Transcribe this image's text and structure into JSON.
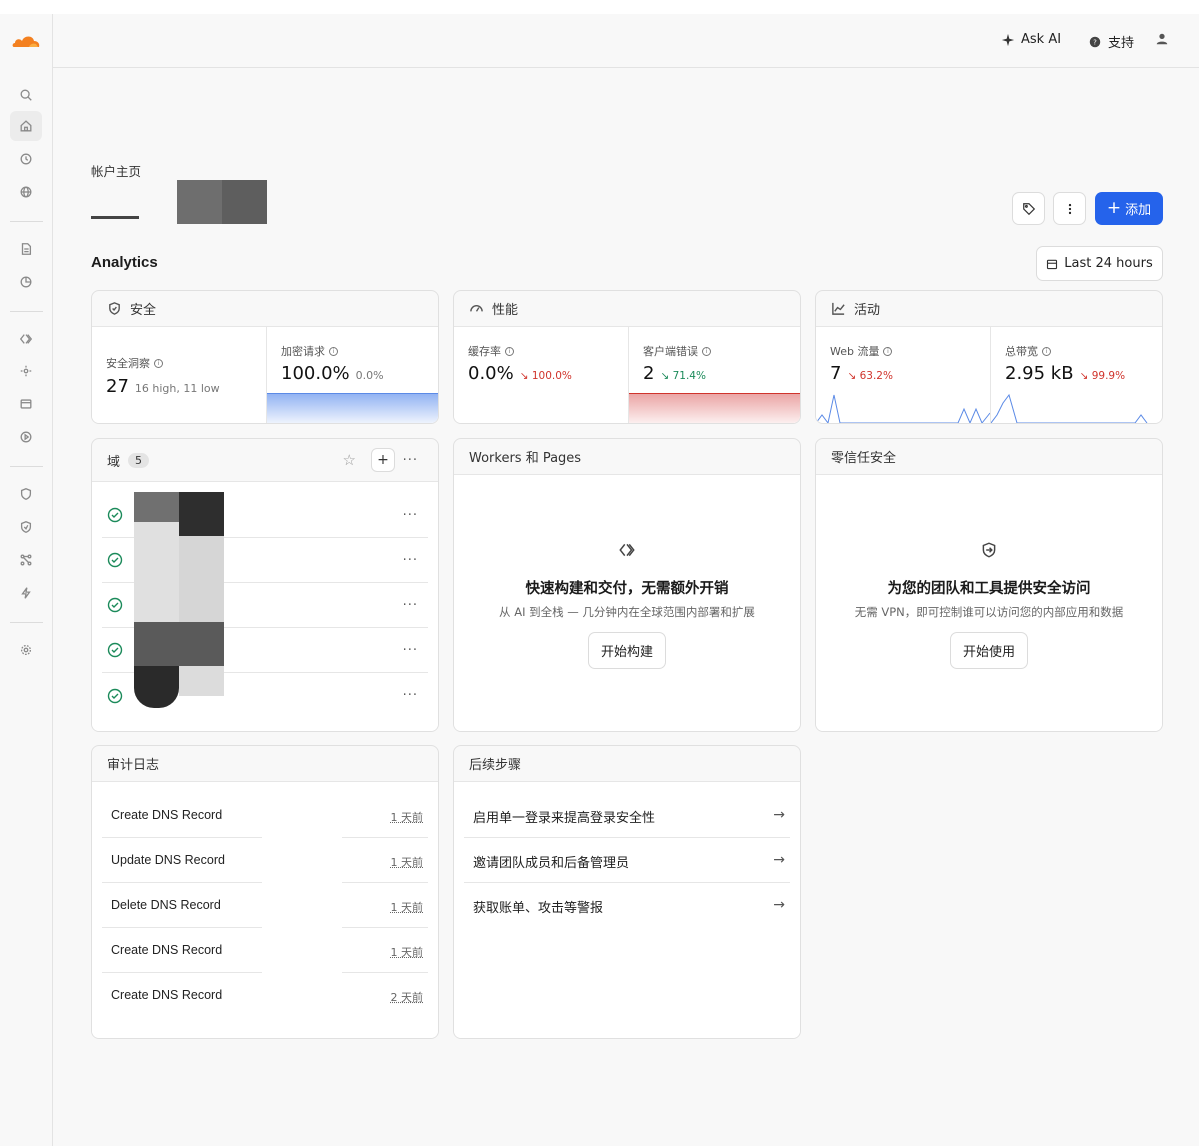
{
  "topbar": {
    "ask_ai": "Ask AI",
    "support": "支持"
  },
  "page": {
    "breadcrumb": "帐户主页",
    "add_label": "添加",
    "analytics_title": "Analytics",
    "time_range": "Last 24 hours"
  },
  "security": {
    "title": "安全",
    "insights_label": "安全洞察",
    "insights_value": "27",
    "insights_sub": "16 high, 11 low",
    "encrypted_label": "加密请求",
    "encrypted_value": "100.0%",
    "encrypted_delta": "0.0%"
  },
  "performance": {
    "title": "性能",
    "cache_label": "缓存率",
    "cache_value": "0.0%",
    "cache_delta": "↘ 100.0%",
    "client_errors_label": "客户端错误",
    "client_errors_value": "2",
    "client_errors_delta": "↘ 71.4%"
  },
  "activity": {
    "title": "活动",
    "traffic_label": "Web 流量",
    "traffic_value": "7",
    "traffic_delta": "↘ 63.2%",
    "bandwidth_label": "总带宽",
    "bandwidth_value": "2.95 kB",
    "bandwidth_delta": "↘ 99.9%"
  },
  "domains": {
    "title": "域",
    "count": "5",
    "rows": [
      "",
      "",
      "",
      "",
      ""
    ]
  },
  "workers": {
    "title": "Workers 和 Pages",
    "heading": "快速构建和交付，无需额外开销",
    "subtext": "从 AI 到全栈 — 几分钟内在全球范围内部署和扩展",
    "button": "开始构建"
  },
  "zero_trust": {
    "title": "零信任安全",
    "heading": "为您的团队和工具提供安全访问",
    "subtext": "无需 VPN，即可控制谁可以访问您的内部应用和数据",
    "button": "开始使用"
  },
  "audit_log": {
    "title": "审计日志",
    "rows": [
      {
        "label": "Create DNS Record",
        "time": "1 天前"
      },
      {
        "label": "Update DNS Record",
        "time": "1 天前"
      },
      {
        "label": "Delete DNS Record",
        "time": "1 天前"
      },
      {
        "label": "Create DNS Record",
        "time": "1 天前"
      },
      {
        "label": "Create DNS Record",
        "time": "2 天前"
      }
    ]
  },
  "next_steps": {
    "title": "后续步骤",
    "rows": [
      "启用单一登录来提高登录安全性",
      "邀请团队成员和后备管理员",
      "获取账单、攻击等警报"
    ]
  },
  "colors": {
    "brand": "#f38020",
    "primary_button": "#2563eb",
    "status_green": "#1b8a5a",
    "delta_red": "#d0342c"
  },
  "icons": {
    "sidebar": [
      "search-icon",
      "home-icon",
      "history-icon",
      "globe-icon",
      "document-icon",
      "chart-icon",
      "workers-icon",
      "ai-icon",
      "storage-icon",
      "media-icon",
      "shield-icon",
      "zero-trust-icon",
      "network-icon",
      "bolt-icon",
      "gear-icon"
    ]
  }
}
